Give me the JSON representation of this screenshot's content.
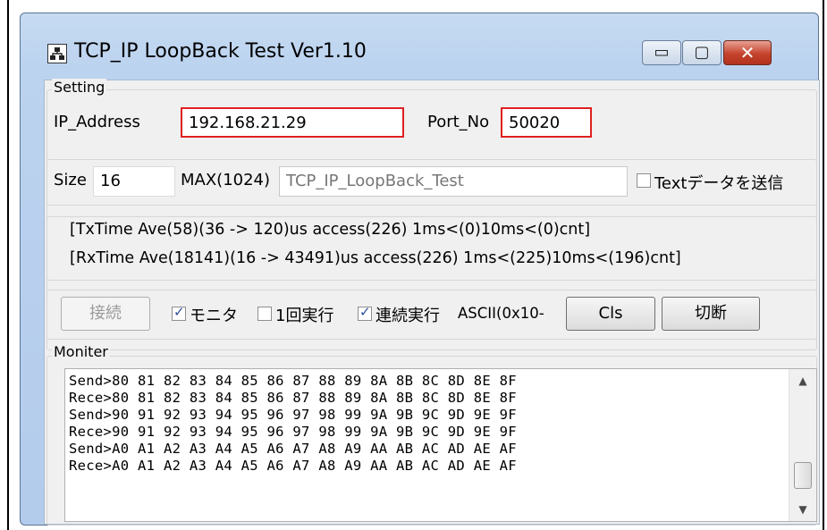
{
  "window": {
    "title": "TCP_IP LoopBack Test Ver1.10",
    "controls": {
      "minimize": "▭",
      "maximize": "▢",
      "close": "✕"
    },
    "app_icon": "network-icon"
  },
  "setting": {
    "group_label": "Setting",
    "ip_label": "IP_Address",
    "ip_value": "192.168.21.29",
    "port_label": "Port_No",
    "port_value": "50020"
  },
  "payload": {
    "size_label": "Size",
    "size_value": "16",
    "max_label": "MAX(1024)",
    "text_value": "TCP_IP_LoopBack_Test",
    "send_text_label": "Textデータを送信",
    "send_text_checked": false
  },
  "stats": {
    "tx": "[TxTime Ave(58)(36 -> 120)us access(226) 1ms<(0)10ms<(0)cnt]",
    "rx": "[RxTime Ave(18141)(16 -> 43491)us access(226) 1ms<(225)10ms<(196)cnt]"
  },
  "actions": {
    "connect_label": "接続",
    "monitor_label": "モニタ",
    "monitor_checked": true,
    "once_label": "1回実行",
    "once_checked": false,
    "continuous_label": "連続実行",
    "continuous_checked": true,
    "ascii_label": "ASCII(0x10-",
    "cls_label": "Cls",
    "disconnect_label": "切断"
  },
  "monitor": {
    "group_label": "Moniter",
    "lines": [
      "Send>80 81 82 83 84 85 86 87 88 89 8A 8B 8C 8D 8E 8F",
      "Rece>80 81 82 83 84 85 86 87 88 89 8A 8B 8C 8D 8E 8F",
      "Send>90 91 92 93 94 95 96 97 98 99 9A 9B 9C 9D 9E 9F",
      "Rece>90 91 92 93 94 95 96 97 98 99 9A 9B 9C 9D 9E 9F",
      "Send>A0 A1 A2 A3 A4 A5 A6 A7 A8 A9 AA AB AC AD AE AF",
      "Rece>A0 A1 A2 A3 A4 A5 A6 A7 A8 A9 AA AB AC AD AE AF"
    ],
    "scroll_up": "▲",
    "scroll_down": "▼"
  }
}
